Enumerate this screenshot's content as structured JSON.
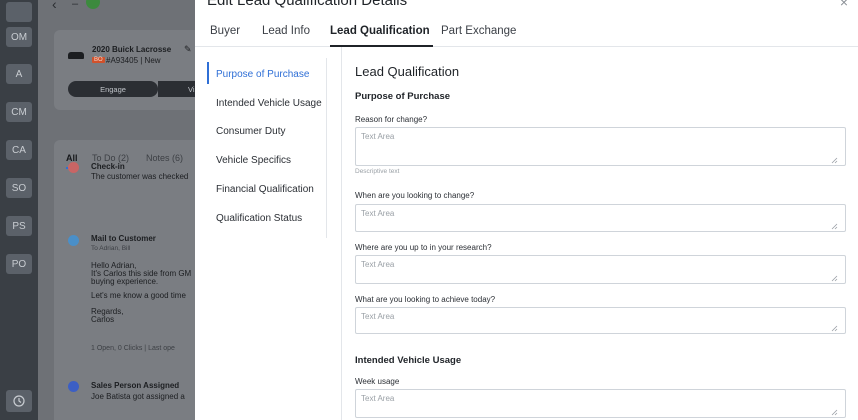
{
  "rail": {
    "badges": [
      "OM",
      "A",
      "CM",
      "CA",
      "SO",
      "PS",
      "PO"
    ]
  },
  "background": {
    "vehicle_title": "2020 Buick Lacrosse",
    "vehicle_tag": "BO",
    "vehicle_sub": "#A93405 | New",
    "engage_label": "Engage",
    "visit_label": "Visi",
    "filters": {
      "all": "All",
      "todo": "To Do (2)",
      "notes": "Notes (6)"
    },
    "checkin": {
      "title": "Check-in",
      "text": "The customer was checked"
    },
    "mail": {
      "title": "Mail to Customer",
      "to": "To Adrian, Bill",
      "line1": "Hello Adrian,",
      "line2": "It's Carlos this side from GM",
      "line3": "buying experience.",
      "line4": "Let's me know a good time",
      "line5": "Regards,",
      "line6": "Carlos",
      "stats": "1 Open, 0 Clicks | Last ope"
    },
    "assigned": {
      "title": "Sales Person Assigned",
      "text": "Joe Batista got assigned a"
    }
  },
  "drawer": {
    "title": "Edit Lead Qualification Details",
    "tabs": [
      {
        "label": "Buyer"
      },
      {
        "label": "Lead Info"
      },
      {
        "label": "Lead Qualification"
      },
      {
        "label": "Part Exchange"
      }
    ],
    "subnav": [
      "Purpose of Purchase",
      "Intended Vehicle Usage",
      "Consumer Duty",
      "Vehicle Specifics",
      "Financial Qualification",
      "Qualification Status"
    ],
    "form": {
      "heading": "Lead Qualification",
      "section1": "Purpose of Purchase",
      "fields": [
        {
          "label": "Reason for change?",
          "placeholder": "Text Area",
          "helper": "Descriptive text"
        },
        {
          "label": "When are you looking to change?",
          "placeholder": "Text Area"
        },
        {
          "label": "Where are you up to in your research?",
          "placeholder": "Text Area"
        },
        {
          "label": "What are you looking to achieve today?",
          "placeholder": "Text Area"
        }
      ],
      "section2": "Intended Vehicle Usage",
      "week_usage": {
        "label": "Week usage",
        "placeholder": "Text Area"
      }
    }
  },
  "colors": {
    "accent": "#2f6fd6",
    "rail": "#3a3f45",
    "overlay": "#6e7176",
    "tag": "#d1512b"
  }
}
